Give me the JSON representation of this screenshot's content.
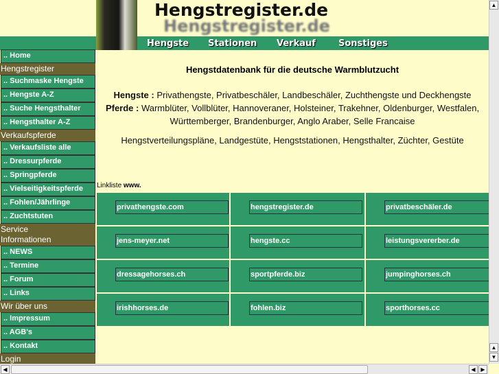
{
  "header": {
    "logo": "Hengstregister.de",
    "logo_shadow": "Hengstregister.de",
    "nav": [
      "Hengste",
      "Stationen",
      "Verkauf",
      "Sonstiges"
    ]
  },
  "sidebar": [
    {
      "type": "item",
      "label": ".. Home"
    },
    {
      "type": "head",
      "label": "Hengstregister"
    },
    {
      "type": "item",
      "label": ".. Suchmaske Hengste"
    },
    {
      "type": "item",
      "label": ".. Hengste A-Z"
    },
    {
      "type": "item",
      "label": ".. Suche Hengsthalter"
    },
    {
      "type": "item",
      "label": ".. Hengsthalter A-Z"
    },
    {
      "type": "head",
      "label": "Verkaufspferde"
    },
    {
      "type": "item",
      "label": ".. Verkaufsliste alle"
    },
    {
      "type": "item",
      "label": ".. Dressurpferde"
    },
    {
      "type": "item",
      "label": ".. Springpferde"
    },
    {
      "type": "item",
      "label": ".. Vielseitigkeitspferde"
    },
    {
      "type": "item",
      "label": ".. Fohlen/Jährlinge"
    },
    {
      "type": "item",
      "label": ".. Zuchtstuten"
    },
    {
      "type": "head",
      "label": "Service Informationen"
    },
    {
      "type": "item",
      "label": ".. NEWS"
    },
    {
      "type": "item",
      "label": ".. Termine"
    },
    {
      "type": "item",
      "label": ".. Forum"
    },
    {
      "type": "item",
      "label": ".. Links"
    },
    {
      "type": "head",
      "label": "Wir über uns"
    },
    {
      "type": "item",
      "label": ".. Impressum"
    },
    {
      "type": "item",
      "label": ".. AGB's"
    },
    {
      "type": "item",
      "label": ".. Kontakt"
    },
    {
      "type": "head",
      "label": "Login"
    }
  ],
  "main": {
    "title": "Hengstdatenbank für die deutsche Warmblutzucht",
    "hengste_label": "Hengste :",
    "hengste_text": " Privathengste, Privatbeschäler, Landbeschäler, Zuchthengste und Deckhengste",
    "pferde_label": "Pferde :",
    "pferde_text": " Warmblüter, Vollblüter, Hannoveraner, Holsteiner, Trakehner, Oldenburger, Westfalen, Württemberger, Brandenburger, Anglo Araber, Selle Francaise",
    "extra": "Hengstverteilungspläne, Landgestüte, Hengststationen, Hengsthalter, Züchter, Gestüte",
    "linkliste_label": "Linkliste ",
    "linkliste_www": "www.",
    "links": [
      "privathengste.com",
      "hengstregister.de",
      "privatbeschäler.de",
      "jens-meyer.net",
      "hengste.cc",
      "leistungsvererber.de",
      "dressagehorses.ch",
      "sportpferde.biz",
      "jumpinghorses.ch",
      "irishhorses.de",
      "fohlen.biz",
      "sporthorses.cc"
    ]
  },
  "colors": {
    "background": "#fefdca",
    "green": "#2f9967",
    "section": "#6b6332"
  }
}
